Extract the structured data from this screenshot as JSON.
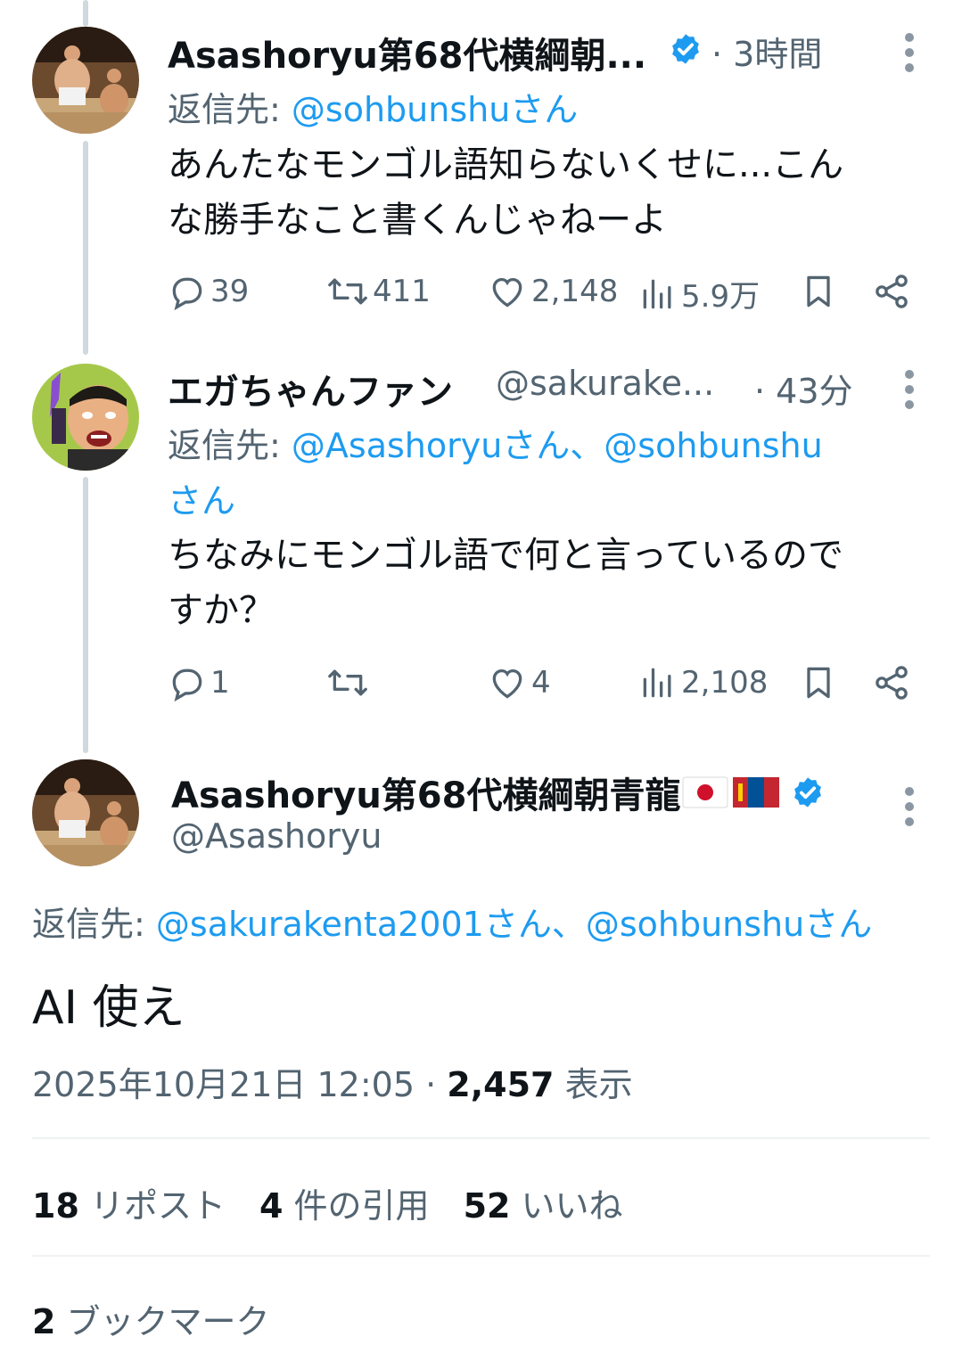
{
  "tweet1": {
    "display_name": "Asashoryu第68代横綱朝...",
    "time": "· 3時間",
    "reply_prefix": "返信先:",
    "reply_handles": "@sohbunshuさん",
    "text_line1": "あんたなモンゴル語知らないくせに...こん",
    "text_line2": "な勝手なこと書くんじゃねーよ",
    "replies": "39",
    "reposts": "411",
    "likes": "2,148",
    "views": "5.9万"
  },
  "tweet2": {
    "display_name": "エガちゃんファン",
    "handle": "@sakurake...",
    "time": "· 43分",
    "reply_prefix": "返信先:",
    "reply_handles_line1": "@Asashoryuさん、@sohbunshu",
    "reply_handles_line2": "さん",
    "text_line1": "ちなみにモンゴル語で何と言っているので",
    "text_line2": "すか？",
    "replies": "1",
    "reposts": "",
    "likes": "4",
    "views": "2,108"
  },
  "main_tweet": {
    "display_name": "Asashoryu第68代横綱朝青龍",
    "handle": "@Asashoryu",
    "reply_prefix": "返信先:",
    "reply_handles": "@sakurakenta2001さん、@sohbunshuさん",
    "text": "AI 使え",
    "timestamp": "2025年10月21日 12:05 ·",
    "views_count": "2,457",
    "views_label": "表示",
    "reposts_count": "18",
    "reposts_label": "リポスト",
    "quotes_count": "4",
    "quotes_label": "件の引用",
    "likes_count": "52",
    "likes_label": "いいね",
    "bookmarks_count": "2",
    "bookmarks_label": "ブックマーク"
  },
  "colors": {
    "link": "#1d9bf0",
    "secondary_text": "#536471",
    "primary_text": "#0f1419",
    "thread_line": "#cfd9de",
    "verified": "#1d9bf0"
  },
  "icons": [
    "reply-icon",
    "repost-icon",
    "like-icon",
    "views-icon",
    "bookmark-icon",
    "share-icon",
    "verified-icon",
    "more-icon",
    "japan-flag-icon",
    "mongolia-flag-icon"
  ]
}
